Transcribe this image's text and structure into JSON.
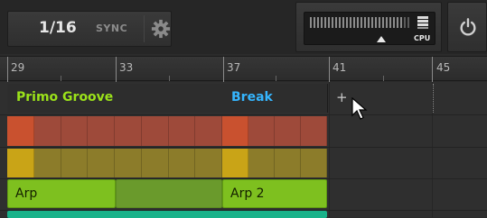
{
  "header": {
    "quantize": "1/16",
    "sync_label": "SYNC",
    "icons": {
      "settings": "gear-icon",
      "cpu": "cpu-icon",
      "power": "power-icon"
    },
    "cpu_label": "CPU"
  },
  "ruler": {
    "bars": [
      "29",
      "33",
      "37",
      "41",
      "45"
    ]
  },
  "scenes": [
    {
      "label": "Primo Groove",
      "color": "#9be21a"
    },
    {
      "label": "Break",
      "color": "#35b6ff"
    }
  ],
  "add_scene_label": "+",
  "tracks": {
    "clips": [
      {
        "label": "Arp"
      },
      {
        "label": "Arp 2"
      }
    ]
  },
  "colors": {
    "red_pattern": "#c8503a",
    "yellow_pattern": "#bfa21e",
    "green_clip": "#7ec01f",
    "teal_clip": "#19b28a",
    "background": "#2b2b2b"
  }
}
